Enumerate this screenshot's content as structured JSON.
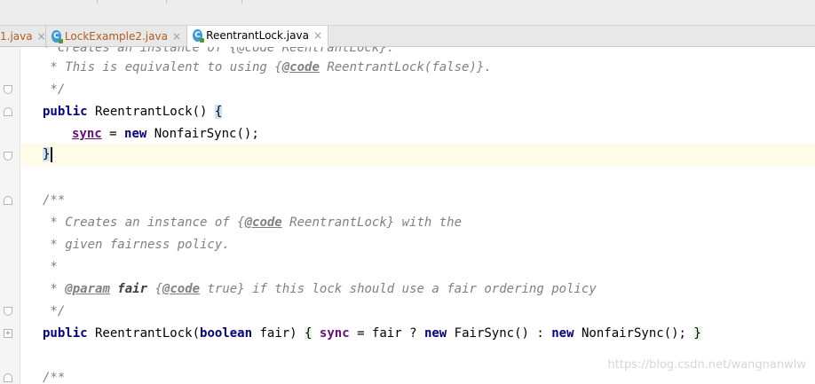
{
  "tabs": [
    {
      "label": "1.java",
      "icon": "",
      "active": false
    },
    {
      "label": "LockExample2.java",
      "icon": "java-class-icon",
      "active": false
    },
    {
      "label": "ReentrantLock.java",
      "icon": "java-class-icon",
      "active": true
    }
  ],
  "tab_close_glyph": "×",
  "file_icon_letter": "C",
  "code": {
    "l0": "* Creates an instance of {@code ReentrantLock}.",
    "l1_a": " * This is equivalent to using ",
    "l1_tag": "@code",
    "l1_b": " ReentrantLock(false)}.",
    "l1_open": "{",
    "l2": " */",
    "l3_kw": "public",
    "l3_rest": " ReentrantLock() ",
    "l3_brace": "{",
    "l4_field": "sync",
    "l4_mid": " = ",
    "l4_kw": "new",
    "l4_rest": " NonfairSync();",
    "l5_brace": "}",
    "l7": "/**",
    "l8_a": " * Creates an instance of ",
    "l8_open": "{",
    "l8_tag": "@code",
    "l8_b": " ReentrantLock} with the",
    "l9": " * given fairness policy.",
    "l10": " *",
    "l11_a": " * ",
    "l11_tag": "@param",
    "l11_param": " fair",
    "l11_sp": " ",
    "l11_open": "{",
    "l11_tag2": "@code",
    "l11_b": " true} if this lock should use a fair ordering policy",
    "l12": " */",
    "l13_kw": "public",
    "l13_a": " ReentrantLock(",
    "l13_kw2": "boolean",
    "l13_b": " fair) ",
    "l13_open": "{",
    "l13_sp": " ",
    "l13_field": "sync",
    "l13_c": " = fair ? ",
    "l13_kw3": "new",
    "l13_d": " FairSync() : ",
    "l13_kw4": "new",
    "l13_e": " NonfairSync(); ",
    "l13_close": "}",
    "l15": "/**"
  },
  "watermark": "https://blog.csdn.net/wangnanwlw",
  "colors": {
    "keyword": "#000080",
    "field": "#660e7a",
    "comment": "#808080",
    "caret_row": "#fefbe7",
    "brace_match": "#cde0f4",
    "inactive_tab_text": "#b35c1e"
  }
}
